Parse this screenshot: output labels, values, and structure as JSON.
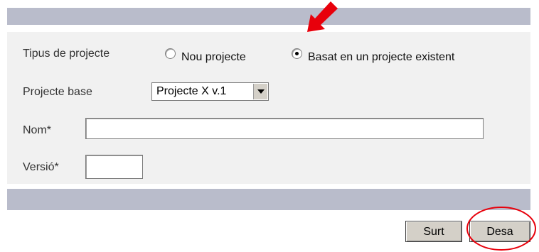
{
  "form": {
    "project_type": {
      "label": "Tipus de projecte",
      "options": [
        {
          "label": "Nou projecte",
          "selected": false
        },
        {
          "label": "Basat en un projecte existent",
          "selected": true
        }
      ]
    },
    "base_project": {
      "label": "Projecte base",
      "selected_value": "Projecte X v.1"
    },
    "name": {
      "label": "Nom*",
      "value": ""
    },
    "version": {
      "label": "Versió*",
      "value": ""
    }
  },
  "buttons": {
    "exit_label": "Surt",
    "save_label": "Desa"
  },
  "colors": {
    "band": "#b9bccb",
    "panel": "#f1f1f1",
    "annotation": "#e8000b"
  },
  "annotations": {
    "arrow_icon": "red-arrow-icon",
    "circle_icon": "red-circle-highlight-icon"
  }
}
